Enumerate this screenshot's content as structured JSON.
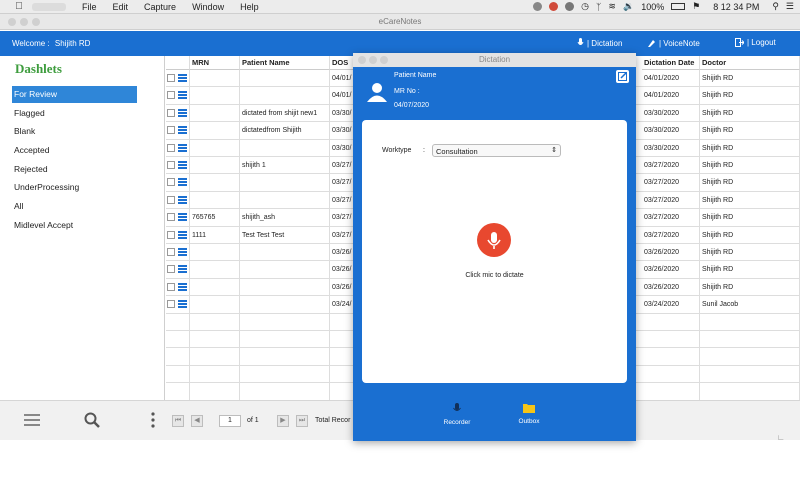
{
  "menubar": {
    "menus": [
      "File",
      "Edit",
      "Capture",
      "Window",
      "Help"
    ],
    "battery": "100%",
    "clock": "8 12 34 PM"
  },
  "window": {
    "title": "eCareNotes"
  },
  "header": {
    "welcome_label": "Welcome :",
    "user": "Shijith RD",
    "dictation": "| Dictation",
    "voicenote": "| VoiceNote",
    "logout": "| Logout"
  },
  "sidebar": {
    "title": "Dashlets",
    "items": [
      "For Review",
      "Flagged",
      "Blank",
      "Accepted",
      "Rejected",
      "UnderProcessing",
      "All",
      "Midlevel Accept"
    ]
  },
  "table": {
    "headers": {
      "mrn": "MRN",
      "patient": "Patient Name",
      "dos": "DOS",
      "dictation_date": "Dictation Date",
      "doctor": "Doctor"
    },
    "rows": [
      {
        "mrn": "",
        "patient": "",
        "dos": "04/01/",
        "date": "04/01/2020",
        "doctor": "Shijith RD"
      },
      {
        "mrn": "",
        "patient": "",
        "dos": "04/01/",
        "date": "04/01/2020",
        "doctor": "Shijith RD"
      },
      {
        "mrn": "",
        "patient": "dictated from shijit  new1",
        "dos": "03/30/",
        "date": "03/30/2020",
        "doctor": "Shijith RD"
      },
      {
        "mrn": "",
        "patient": "dictatedfrom Shijith",
        "dos": "03/30/",
        "date": "03/30/2020",
        "doctor": "Shijith RD"
      },
      {
        "mrn": "",
        "patient": "",
        "dos": "03/30/",
        "date": "03/30/2020",
        "doctor": "Shijith RD"
      },
      {
        "mrn": "",
        "patient": "shijith 1",
        "dos": "03/27/",
        "date": "03/27/2020",
        "doctor": "Shijith RD"
      },
      {
        "mrn": "",
        "patient": "",
        "dos": "03/27/",
        "date": "03/27/2020",
        "doctor": "Shijith RD"
      },
      {
        "mrn": "",
        "patient": "",
        "dos": "03/27/",
        "date": "03/27/2020",
        "doctor": "Shijith RD"
      },
      {
        "mrn": "765765",
        "patient": "shijith_ash",
        "dos": "03/27/",
        "date": "03/27/2020",
        "doctor": "Shijith RD"
      },
      {
        "mrn": "1111",
        "patient": "Test Test Test",
        "dos": "03/27/",
        "date": "03/27/2020",
        "doctor": "Shijith RD"
      },
      {
        "mrn": "",
        "patient": "",
        "dos": "03/26/",
        "date": "03/26/2020",
        "doctor": "Shijith RD"
      },
      {
        "mrn": "",
        "patient": "",
        "dos": "03/26/",
        "date": "03/26/2020",
        "doctor": "Shijith RD"
      },
      {
        "mrn": "",
        "patient": "",
        "dos": "03/26/",
        "date": "03/26/2020",
        "doctor": "Shijith RD"
      },
      {
        "mrn": "",
        "patient": "",
        "dos": "03/24/",
        "date": "03/24/2020",
        "doctor": "Sunil Jacob"
      }
    ]
  },
  "pager": {
    "page": "1",
    "of": "of 1",
    "total": "Total Recor"
  },
  "dictation": {
    "title": "Dictation",
    "patient_label": "Patient Name",
    "mr_label": "MR No :",
    "date": "04/07/2020",
    "worktype_label": "Worktype",
    "colon": ":",
    "worktype_value": "Consultation",
    "mic_hint": "Click mic to dictate",
    "recorder": "Recorder",
    "outbox": "Outbox"
  },
  "colors": {
    "brand": "#1a6fd1",
    "dashlet_title": "#3d9c3d",
    "mic": "#e8482f"
  }
}
